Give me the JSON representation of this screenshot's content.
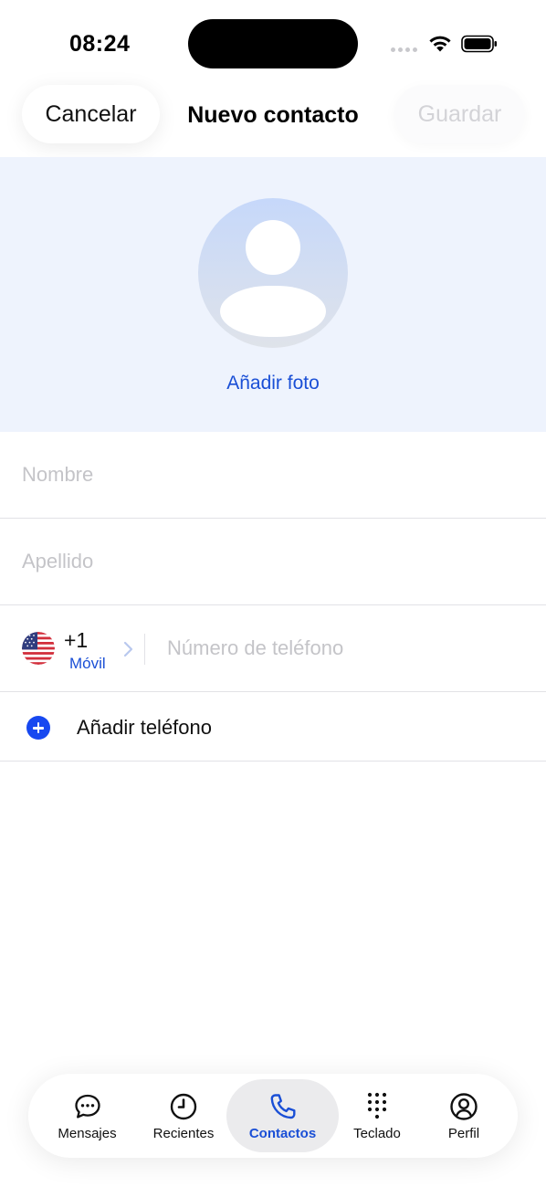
{
  "status_bar": {
    "time": "08:24"
  },
  "header": {
    "cancel_label": "Cancelar",
    "title": "Nuevo contacto",
    "save_label": "Guardar"
  },
  "photo": {
    "add_photo_label": "Añadir foto"
  },
  "form": {
    "first_name_placeholder": "Nombre",
    "last_name_placeholder": "Apellido",
    "country_code": "+1",
    "phone_type": "Móvil",
    "phone_placeholder": "Número de teléfono",
    "add_phone_label": "Añadir teléfono"
  },
  "tab_bar": {
    "active": "Contactos",
    "tabs": [
      {
        "label": "Mensajes",
        "icon": "chat-bubble-icon"
      },
      {
        "label": "Recientes",
        "icon": "clock-icon"
      },
      {
        "label": "Contactos",
        "icon": "phone-icon"
      },
      {
        "label": "Teclado",
        "icon": "keypad-icon"
      },
      {
        "label": "Perfil",
        "icon": "profile-icon"
      }
    ]
  },
  "colors": {
    "accent": "#1a4fd6",
    "add_button": "#1748f0",
    "photo_background": "#eef3fd",
    "placeholder": "#c4c4c8"
  }
}
